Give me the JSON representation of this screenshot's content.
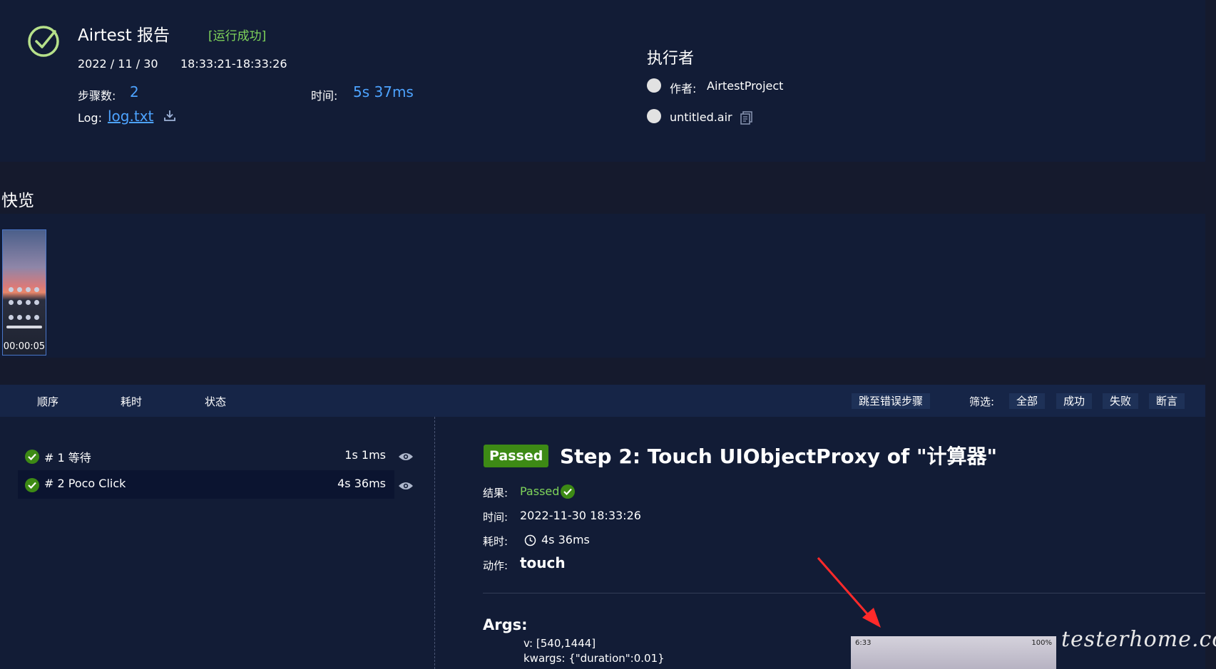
{
  "header": {
    "title": "Airtest 报告",
    "status": "[运行成功]",
    "date": "2022 / 11 / 30",
    "time_range": "18:33:21-18:33:26",
    "steps_label": "步骤数:",
    "steps_value": "2",
    "duration_label": "时间:",
    "duration_value": "5s 37ms",
    "log_label": "Log:",
    "log_link": "log.txt"
  },
  "executor": {
    "title": "执行者",
    "author_label": "作者:",
    "author": "AirtestProject",
    "script": "untitled.air"
  },
  "overview": {
    "title": "快览",
    "thumbnail_time": "00:00:05"
  },
  "steps_table": {
    "columns": [
      "顺序",
      "耗时",
      "状态"
    ],
    "jump_error": "跳至错误步骤",
    "filter_label": "筛选:",
    "filters": [
      "全部",
      "成功",
      "失败",
      "断言"
    ],
    "rows": [
      {
        "title": "# 1 等待",
        "time": "1s 1ms"
      },
      {
        "title": "# 2 Poco Click",
        "time": "4s 36ms"
      }
    ]
  },
  "detail": {
    "badge": "Passed",
    "heading": "Step 2: Touch UIObjectProxy of \"计算器\"",
    "result_label": "结果:",
    "result_value": "Passed",
    "time_label": "时间:",
    "time_value": "2022-11-30 18:33:26",
    "elapsed_label": "耗时:",
    "elapsed_value": "4s 36ms",
    "action_label": "动作:",
    "action_value": "touch",
    "args_title": "Args:",
    "args": [
      "v: [540,1444]",
      "kwargs: {\"duration\":0.01}"
    ]
  },
  "screenshot": {
    "status_time": "6:33",
    "battery": "100%"
  },
  "watermark": "testerhome.com",
  "colors": {
    "page_bg": "#151a2d",
    "panel_bg": "#121c36",
    "success_green": "#7fd45a",
    "link_blue": "#4da3ff",
    "badge_green": "#3d8a15",
    "arrow_red": "#ff2a2a"
  }
}
